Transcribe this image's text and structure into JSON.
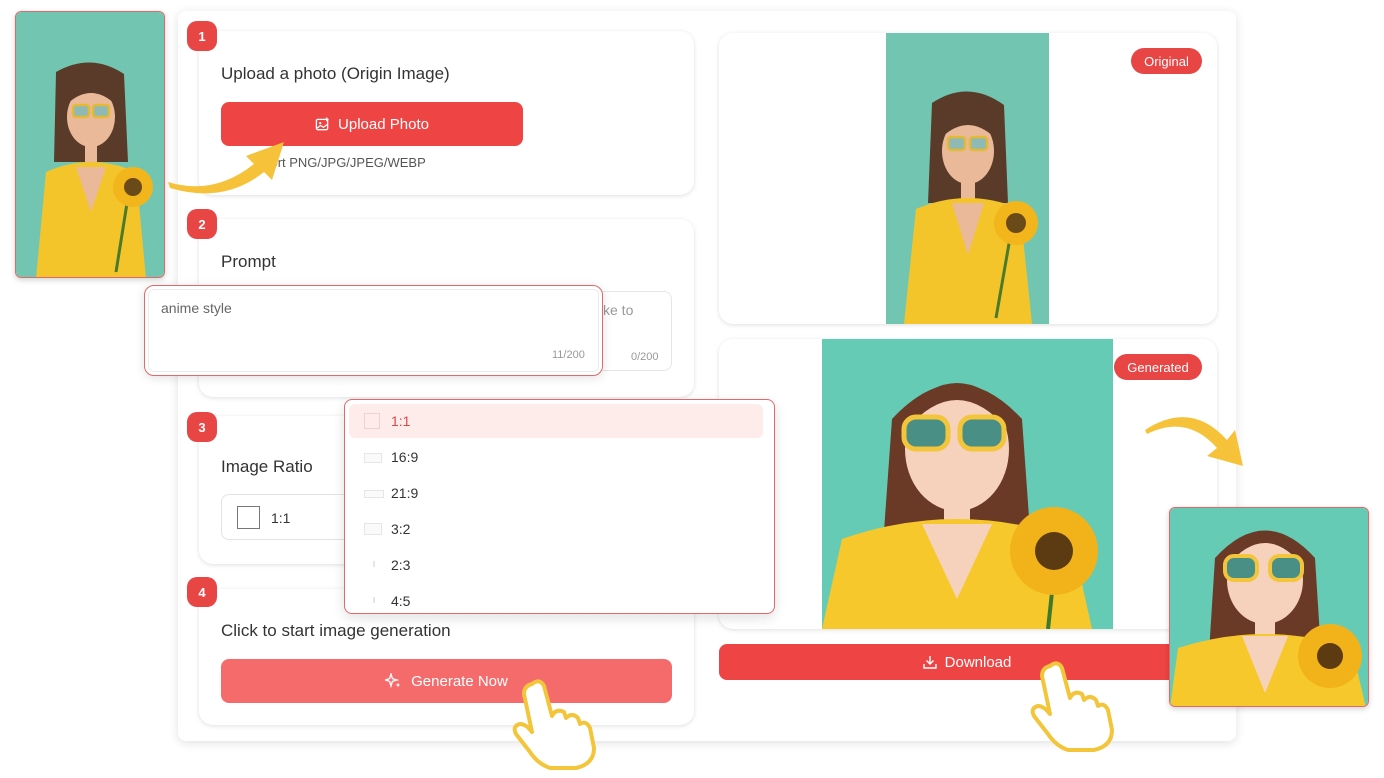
{
  "steps": {
    "upload": {
      "number": "1",
      "title": "Upload a photo (Origin Image)",
      "button_label": "Upload Photo",
      "support_text": "Support PNG/JPG/JPEG/WEBP",
      "support_visible": "pport PNG/JPG/JPEG/WEBP"
    },
    "prompt": {
      "number": "2",
      "title": "Prompt",
      "placeholder_fragment": "ke to",
      "counter": "0/200"
    },
    "ratio": {
      "number": "3",
      "title": "Image Ratio",
      "selected": "1:1"
    },
    "generate": {
      "number": "4",
      "title": "Click to start image generation",
      "button_label": "Generate Now"
    }
  },
  "prompt_popup": {
    "value": "anime style",
    "counter": "11/200"
  },
  "ratio_dropdown": {
    "options": [
      "1:1",
      "16:9",
      "21:9",
      "3:2",
      "2:3",
      "4:5"
    ],
    "selected_index": 0
  },
  "preview": {
    "original_tag": "Original",
    "generated_tag": "Generated",
    "download_label": "Download"
  },
  "colors": {
    "accent": "#ef4444",
    "accent_light": "#f56b6b",
    "badge": "#e84545",
    "arrow": "#f5c23a",
    "teal": "#6cc6b0"
  },
  "icons": [
    "image-plus-icon",
    "sparkle-icon",
    "download-icon",
    "pointer-hand-icon",
    "curved-arrow-icon"
  ]
}
